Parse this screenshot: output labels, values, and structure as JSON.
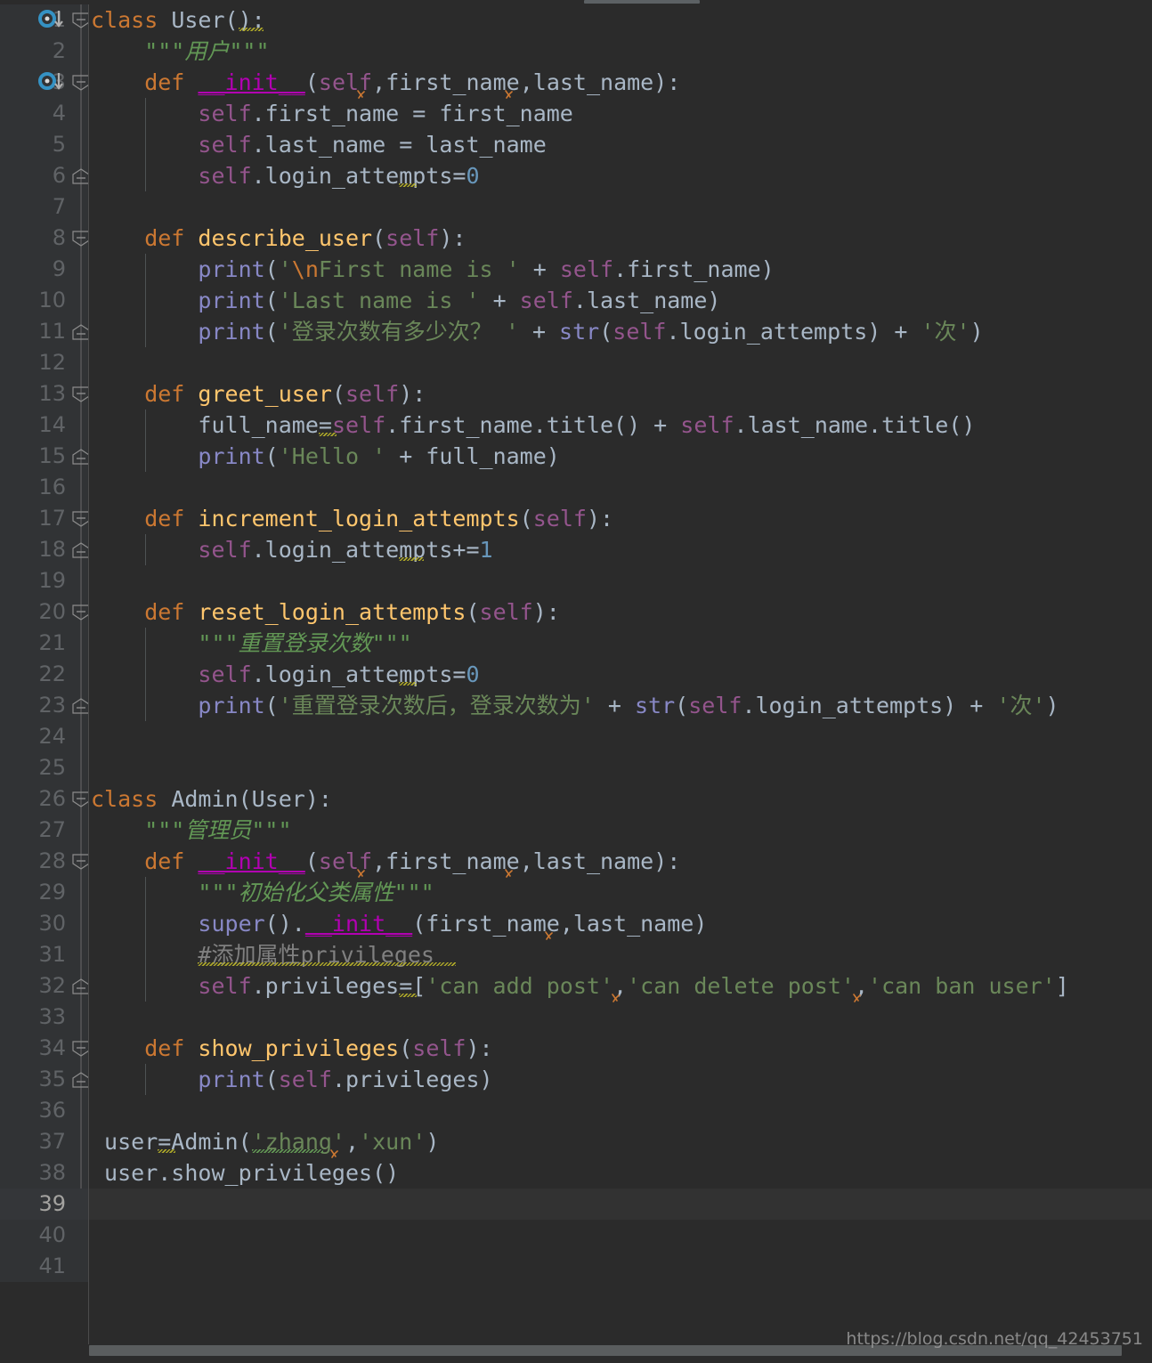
{
  "editor": {
    "theme_name": "darcula",
    "background": "#2b2b2b",
    "gutter_background": "#313335",
    "current_line": 39,
    "total_visible_lines": 41,
    "language": "python",
    "watermark": "https://blog.csdn.net/qq_42453751"
  },
  "colors": {
    "keyword": "#cc7832",
    "function_def": "#ffc66d",
    "identifier": "#a9b7c6",
    "self_keyword": "#94558d",
    "magic_method": "#b200b2",
    "builtin": "#8888c6",
    "string": "#6a8759",
    "docstring": "#629755",
    "number": "#6897bb",
    "comment": "#808080",
    "gutter_text": "#606366",
    "warning_squiggle": "#bbb529",
    "gutter_marker": "#3592c4"
  },
  "gutter": {
    "line_numbers": [
      1,
      2,
      3,
      4,
      5,
      6,
      7,
      8,
      9,
      10,
      11,
      12,
      13,
      14,
      15,
      16,
      17,
      18,
      19,
      20,
      21,
      22,
      23,
      24,
      25,
      26,
      27,
      28,
      29,
      30,
      31,
      32,
      33,
      34,
      35,
      36,
      37,
      38,
      39,
      40,
      41
    ],
    "override_markers_on_lines": [
      1,
      3
    ],
    "fold_open_lines": [
      1,
      3,
      8,
      13,
      17,
      20,
      26,
      28,
      34
    ],
    "fold_end_lines": [
      6,
      11,
      15,
      18,
      23,
      32,
      35
    ]
  },
  "code_lines": [
    {
      "n": 1,
      "text": "class User():"
    },
    {
      "n": 2,
      "text": "    \"\"\"用户\"\"\""
    },
    {
      "n": 3,
      "text": "    def __init__(self,first_name,last_name):"
    },
    {
      "n": 4,
      "text": "        self.first_name = first_name"
    },
    {
      "n": 5,
      "text": "        self.last_name = last_name"
    },
    {
      "n": 6,
      "text": "        self.login_attempts=0"
    },
    {
      "n": 7,
      "text": ""
    },
    {
      "n": 8,
      "text": "    def describe_user(self):"
    },
    {
      "n": 9,
      "text": "        print('\\nFirst name is ' + self.first_name)"
    },
    {
      "n": 10,
      "text": "        print('Last name is ' + self.last_name)"
    },
    {
      "n": 11,
      "text": "        print('登录次数有多少次？ ' + str(self.login_attempts) + '次')"
    },
    {
      "n": 12,
      "text": ""
    },
    {
      "n": 13,
      "text": "    def greet_user(self):"
    },
    {
      "n": 14,
      "text": "        full_name=self.first_name.title() + self.last_name.title()"
    },
    {
      "n": 15,
      "text": "        print('Hello ' + full_name)"
    },
    {
      "n": 16,
      "text": ""
    },
    {
      "n": 17,
      "text": "    def increment_login_attempts(self):"
    },
    {
      "n": 18,
      "text": "        self.login_attempts+=1"
    },
    {
      "n": 19,
      "text": ""
    },
    {
      "n": 20,
      "text": "    def reset_login_attempts(self):"
    },
    {
      "n": 21,
      "text": "        \"\"\"重置登录次数\"\"\""
    },
    {
      "n": 22,
      "text": "        self.login_attempts=0"
    },
    {
      "n": 23,
      "text": "        print('重置登录次数后，登录次数为' + str(self.login_attempts) + '次')"
    },
    {
      "n": 24,
      "text": ""
    },
    {
      "n": 25,
      "text": ""
    },
    {
      "n": 26,
      "text": "class Admin(User):"
    },
    {
      "n": 27,
      "text": "    \"\"\"管理员\"\"\""
    },
    {
      "n": 28,
      "text": "    def __init__(self,first_name,last_name):"
    },
    {
      "n": 29,
      "text": "        \"\"\"初始化父类属性\"\"\""
    },
    {
      "n": 30,
      "text": "        super().__init__(first_name,last_name)"
    },
    {
      "n": 31,
      "text": "        #添加属性privileges"
    },
    {
      "n": 32,
      "text": "        self.privileges=['can add post','can delete post','can ban user']"
    },
    {
      "n": 33,
      "text": ""
    },
    {
      "n": 34,
      "text": "    def show_privileges(self):"
    },
    {
      "n": 35,
      "text": "        print(self.privileges)"
    },
    {
      "n": 36,
      "text": ""
    },
    {
      "n": 37,
      "text": "user=Admin('zhang','xun')"
    },
    {
      "n": 38,
      "text": "user.show_privileges()"
    },
    {
      "n": 39,
      "text": ""
    },
    {
      "n": 40,
      "text": ""
    },
    {
      "n": 41,
      "text": ""
    }
  ],
  "tokens": {
    "l1": [
      [
        "kw",
        "class"
      ],
      [
        "plain",
        " "
      ],
      [
        "cls",
        "User"
      ],
      [
        "plain",
        "("
      ],
      [
        "plain",
        ")"
      ],
      [
        "plain",
        ":"
      ]
    ],
    "l2": [
      [
        "doc",
        "    \"\"\"用户\"\"\""
      ]
    ],
    "l3": [
      [
        "kw",
        "    def "
      ],
      [
        "magic",
        "__init__"
      ],
      [
        "plain",
        "("
      ],
      [
        "self",
        "self"
      ],
      [
        "plain",
        ","
      ],
      [
        "plain",
        "first_name"
      ],
      [
        "plain",
        ","
      ],
      [
        "plain",
        "last_name"
      ],
      [
        "plain",
        "):"
      ]
    ],
    "l4": [
      [
        "self",
        "        self"
      ],
      [
        "plain",
        ".first_name = first_name"
      ]
    ],
    "l5": [
      [
        "self",
        "        self"
      ],
      [
        "plain",
        ".last_name = last_name"
      ]
    ],
    "l6": [
      [
        "self",
        "        self"
      ],
      [
        "plain",
        ".login_attempts="
      ],
      [
        "num",
        "0"
      ]
    ],
    "l8": [
      [
        "kw",
        "    def "
      ],
      [
        "fn",
        "describe_user"
      ],
      [
        "plain",
        "("
      ],
      [
        "self",
        "self"
      ],
      [
        "plain",
        "):"
      ]
    ],
    "l9": [
      [
        "builtin",
        "        print"
      ],
      [
        "plain",
        "("
      ],
      [
        "str",
        "'"
      ],
      [
        "esc",
        "\\n"
      ],
      [
        "str",
        "First name is '"
      ],
      [
        "plain",
        " + "
      ],
      [
        "self",
        "self"
      ],
      [
        "plain",
        ".first_name)"
      ]
    ],
    "l10": [
      [
        "builtin",
        "        print"
      ],
      [
        "plain",
        "("
      ],
      [
        "str",
        "'Last name is '"
      ],
      [
        "plain",
        " + "
      ],
      [
        "self",
        "self"
      ],
      [
        "plain",
        ".last_name)"
      ]
    ],
    "l11": [
      [
        "builtin",
        "        print"
      ],
      [
        "plain",
        "("
      ],
      [
        "str",
        "'登录次数有多少次？ '"
      ],
      [
        "plain",
        " + "
      ],
      [
        "builtin",
        "str"
      ],
      [
        "plain",
        "("
      ],
      [
        "self",
        "self"
      ],
      [
        "plain",
        ".login_attempts) + "
      ],
      [
        "str",
        "'次'"
      ],
      [
        "plain",
        ")"
      ]
    ],
    "l13": [
      [
        "kw",
        "    def "
      ],
      [
        "fn",
        "greet_user"
      ],
      [
        "plain",
        "("
      ],
      [
        "self",
        "self"
      ],
      [
        "plain",
        "):"
      ]
    ],
    "l14": [
      [
        "plain",
        "        full_name="
      ],
      [
        "self",
        "self"
      ],
      [
        "plain",
        ".first_name.title() + "
      ],
      [
        "self",
        "self"
      ],
      [
        "plain",
        ".last_name.title()"
      ]
    ],
    "l15": [
      [
        "builtin",
        "        print"
      ],
      [
        "plain",
        "("
      ],
      [
        "str",
        "'Hello '"
      ],
      [
        "plain",
        " + full_name)"
      ]
    ],
    "l17": [
      [
        "kw",
        "    def "
      ],
      [
        "fn",
        "increment_login_attempts"
      ],
      [
        "plain",
        "("
      ],
      [
        "self",
        "self"
      ],
      [
        "plain",
        "):"
      ]
    ],
    "l18": [
      [
        "self",
        "        self"
      ],
      [
        "plain",
        ".login_attempts+="
      ],
      [
        "num",
        "1"
      ]
    ],
    "l20": [
      [
        "kw",
        "    def "
      ],
      [
        "fn",
        "reset_login_attempts"
      ],
      [
        "plain",
        "("
      ],
      [
        "self",
        "self"
      ],
      [
        "plain",
        "):"
      ]
    ],
    "l21": [
      [
        "doc",
        "        \"\"\"重置登录次数\"\"\""
      ]
    ],
    "l22": [
      [
        "self",
        "        self"
      ],
      [
        "plain",
        ".login_attempts="
      ],
      [
        "num",
        "0"
      ]
    ],
    "l23": [
      [
        "builtin",
        "        print"
      ],
      [
        "plain",
        "("
      ],
      [
        "str",
        "'重置登录次数后，登录次数为'"
      ],
      [
        "plain",
        " + "
      ],
      [
        "builtin",
        "str"
      ],
      [
        "plain",
        "("
      ],
      [
        "self",
        "self"
      ],
      [
        "plain",
        ".login_attempts) + "
      ],
      [
        "str",
        "'次'"
      ],
      [
        "plain",
        ")"
      ]
    ],
    "l26": [
      [
        "kw",
        "class"
      ],
      [
        "plain",
        " "
      ],
      [
        "cls",
        "Admin"
      ],
      [
        "plain",
        "("
      ],
      [
        "cls",
        "User"
      ],
      [
        "plain",
        "):"
      ]
    ],
    "l27": [
      [
        "doc",
        "    \"\"\"管理员\"\"\""
      ]
    ],
    "l28": [
      [
        "kw",
        "    def "
      ],
      [
        "magic",
        "__init__"
      ],
      [
        "plain",
        "("
      ],
      [
        "self",
        "self"
      ],
      [
        "plain",
        ",first_name,last_name):"
      ]
    ],
    "l29": [
      [
        "doc",
        "        \"\"\"初始化父类属性\"\"\""
      ]
    ],
    "l30": [
      [
        "builtin",
        "        super"
      ],
      [
        "plain",
        "()."
      ],
      [
        "magic",
        "__init__"
      ],
      [
        "plain",
        "(first_name,last_name)"
      ]
    ],
    "l31": [
      [
        "cmt",
        "        #添加属性privileges"
      ]
    ],
    "l32": [
      [
        "self",
        "        self"
      ],
      [
        "plain",
        ".privileges=["
      ],
      [
        "str",
        "'can add post'"
      ],
      [
        "plain",
        ","
      ],
      [
        "str",
        "'can delete post'"
      ],
      [
        "plain",
        ","
      ],
      [
        "str",
        "'can ban user'"
      ],
      [
        "plain",
        "]"
      ]
    ],
    "l34": [
      [
        "kw",
        "    def "
      ],
      [
        "fn",
        "show_privileges"
      ],
      [
        "plain",
        "("
      ],
      [
        "self",
        "self"
      ],
      [
        "plain",
        "):"
      ]
    ],
    "l35": [
      [
        "builtin",
        "        print"
      ],
      [
        "plain",
        "("
      ],
      [
        "self",
        "self"
      ],
      [
        "plain",
        ".privileges)"
      ]
    ],
    "l37": [
      [
        "plain",
        " user=Admin("
      ],
      [
        "str",
        "'zhang'"
      ],
      [
        "plain",
        ","
      ],
      [
        "str",
        "'xun'"
      ],
      [
        "plain",
        ")"
      ]
    ],
    "l38": [
      [
        "plain",
        " user.show_privileges()"
      ]
    ]
  },
  "scrollbars": {
    "horizontal_bottom_visible": true,
    "horizontal_top_fragment_visible": true
  }
}
